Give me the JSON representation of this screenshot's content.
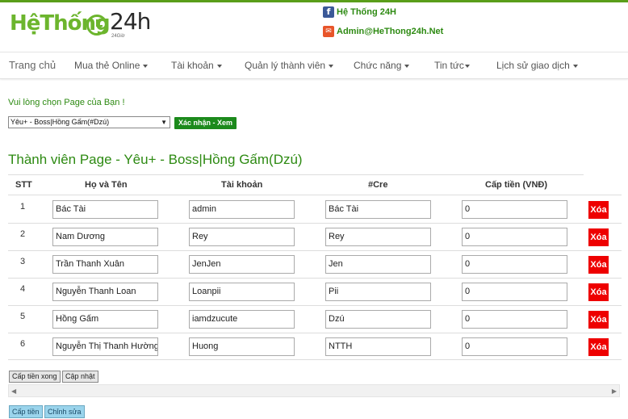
{
  "header": {
    "logo_text": "HệThống",
    "logo_num": "24h",
    "logo_sub": "24Giờ",
    "facebook_label": "Hệ Thống 24H",
    "email_label": "Admin@HeThong24h.Net",
    "facebook_icon": "facebook-icon",
    "email_icon": "email-icon"
  },
  "nav": {
    "items": [
      {
        "label": "Trang chủ",
        "dropdown": false
      },
      {
        "label": "Mua thẻ Online",
        "dropdown": true
      },
      {
        "label": "Tài khoản",
        "dropdown": true
      },
      {
        "label": "Quản lý thành viên",
        "dropdown": true
      },
      {
        "label": "Chức năng",
        "dropdown": true
      },
      {
        "label": "Tin tức",
        "dropdown": true
      },
      {
        "label": "Lịch sử giao dịch",
        "dropdown": true
      }
    ]
  },
  "page_select": {
    "prompt": "Vui lòng chọn Page của Bạn !",
    "selected": "Yêu+ - Boss|Hồng Gấm(#Dzú)",
    "confirm_label": "Xác nhận - Xem"
  },
  "section_title": "Thành viên Page - Yêu+ - Boss|Hồng Gấm(Dzú)",
  "table": {
    "headers": [
      "STT",
      "Họ và Tên",
      "Tài khoản",
      "#Cre",
      "Cấp tiền (VNĐ)"
    ],
    "delete_label": "Xóa",
    "rows": [
      {
        "stt": "1",
        "name": "Bác Tài",
        "account": "admin",
        "cre": "Bác Tài",
        "amount": "0"
      },
      {
        "stt": "2",
        "name": "Nam Dương",
        "account": "Rey",
        "cre": "Rey",
        "amount": "0"
      },
      {
        "stt": "3",
        "name": "Trần Thanh Xuân",
        "account": "JenJen",
        "cre": "Jen",
        "amount": "0"
      },
      {
        "stt": "4",
        "name": "Nguyễn Thanh Loan",
        "account": "Loanpii",
        "cre": "Pii",
        "amount": "0"
      },
      {
        "stt": "5",
        "name": "Hồng Gấm",
        "account": "iamdzucute",
        "cre": "Dzú",
        "amount": "0"
      },
      {
        "stt": "6",
        "name": "Nguyễn Thị Thanh Hường",
        "account": "Huong",
        "cre": "NTTH",
        "amount": "0"
      }
    ]
  },
  "actions": {
    "cap_tien_xong": "Cấp tiền xong",
    "cap_nhat": "Cập nhật",
    "cap_tien": "Cấp tiền",
    "chinh_sua": "Chỉnh sửa"
  },
  "colors": {
    "brand_green": "#6cb52d",
    "text_green": "#2d8a12",
    "confirm_green": "#1c8a1c",
    "delete_red": "#ee0000",
    "blue_button": "#9ad4ec"
  }
}
